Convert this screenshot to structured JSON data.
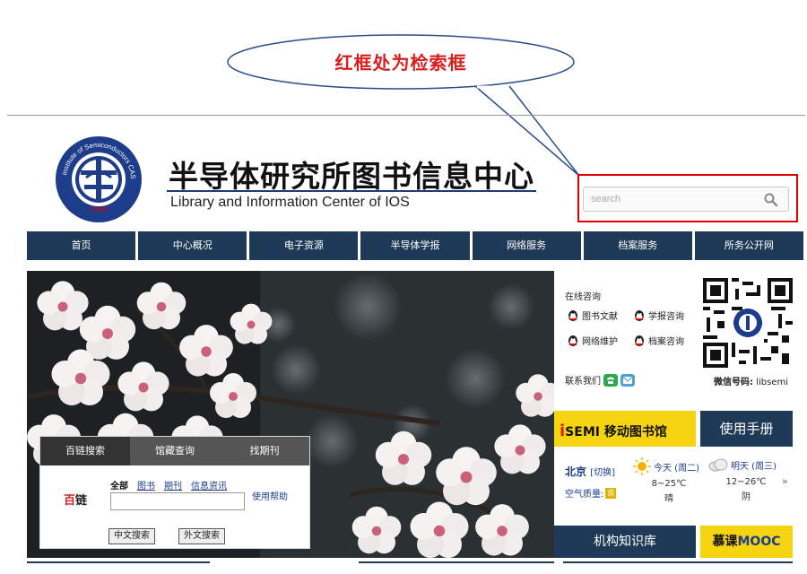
{
  "callout": {
    "text": "红框处为检索框"
  },
  "header": {
    "title_cn": "半导体研究所图书信息中心",
    "title_en": "Library and Information Center of IOS",
    "logo_ring_text": "Institute of Semiconductors CAS",
    "logo_year": "1960"
  },
  "search": {
    "placeholder": "search"
  },
  "nav": {
    "items": [
      {
        "label": "首页"
      },
      {
        "label": "中心概况"
      },
      {
        "label": "电子资源"
      },
      {
        "label": "半导体学报"
      },
      {
        "label": "网络服务"
      },
      {
        "label": "档案服务"
      },
      {
        "label": "所务公开网"
      }
    ]
  },
  "search_panel": {
    "tabs": [
      {
        "label": "百链搜索"
      },
      {
        "label": "馆藏查询"
      },
      {
        "label": "找期刊"
      }
    ],
    "brand_a": "百",
    "brand_b": "链",
    "scopes": [
      {
        "label": "全部"
      },
      {
        "label": "图书"
      },
      {
        "label": "期刊"
      },
      {
        "label": "信息资讯"
      }
    ],
    "help": "使用帮助",
    "btn_cn": "中文搜索",
    "btn_en": "外文搜索"
  },
  "consult": {
    "title": "在线咨询",
    "items": [
      {
        "label": "图书文献"
      },
      {
        "label": "学报咨询"
      },
      {
        "label": "网络维护"
      },
      {
        "label": "档案咨询"
      }
    ],
    "contact": "联系我们"
  },
  "wechat": {
    "label": "微信号码:",
    "id": "libsemi"
  },
  "tiles": {
    "isemi_i": "i",
    "isemi_rest": "SEMI",
    "isemi_suffix": " 移动图书馆",
    "manual": "使用手册",
    "institution": "机构知识库",
    "mooc_a": "慕课",
    "mooc_b": "MOOC"
  },
  "weather": {
    "city": "北京",
    "switch": "[切换]",
    "air_label": "空气质量:",
    "air_badge": "良",
    "today": {
      "day": "今天 (周二)",
      "temp": "8~25℃",
      "cond": "晴"
    },
    "tomorrow": {
      "day": "明天 (周三)",
      "temp": "12~26℃",
      "cond": "阴"
    },
    "more": "»"
  },
  "colors": {
    "nav_bg": "#1f3a57",
    "accent_yellow": "#f6d40f",
    "highlight_red": "#e00000"
  }
}
